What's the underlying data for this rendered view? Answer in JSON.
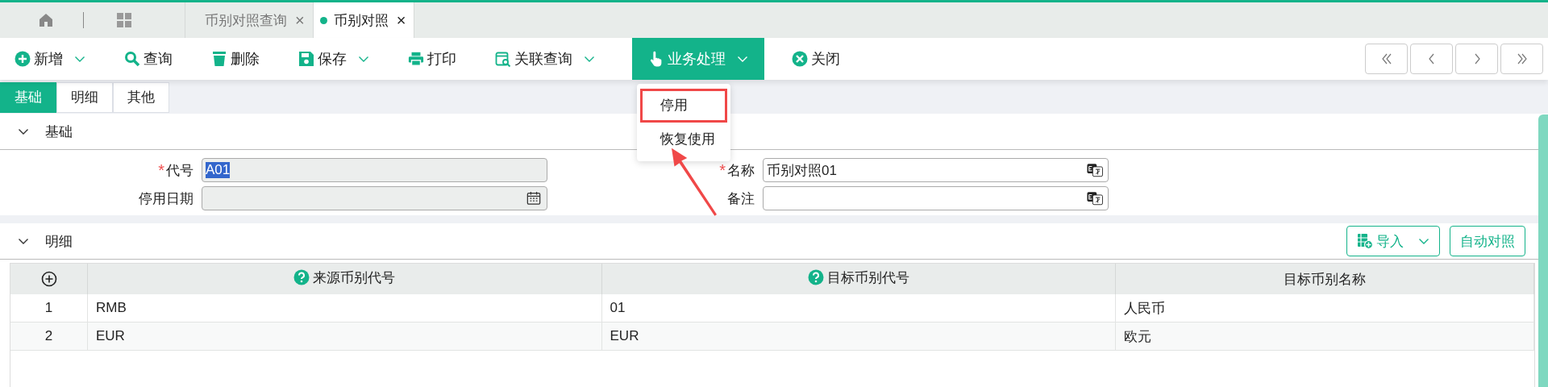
{
  "nav_tabs": [
    {
      "label": "币别对照查询",
      "selected": false,
      "close": "×"
    },
    {
      "label": "币别对照",
      "selected": true,
      "close": "×"
    }
  ],
  "toolbar": {
    "buttons": [
      {
        "label": "新增",
        "kind": "plus",
        "caret": true,
        "selected": false
      },
      {
        "label": "查询",
        "kind": "search",
        "caret": false,
        "selected": false
      },
      {
        "label": "删除",
        "kind": "trash",
        "caret": false,
        "selected": false
      },
      {
        "label": "保存",
        "kind": "save",
        "caret": true,
        "selected": false
      },
      {
        "label": "打印",
        "kind": "print",
        "caret": false,
        "selected": false
      },
      {
        "label": "关联查询",
        "kind": "docsearch",
        "caret": true,
        "selected": false
      },
      {
        "label": "业务处理",
        "kind": "hand",
        "caret": true,
        "selected": true
      },
      {
        "label": "关闭",
        "kind": "close",
        "caret": false,
        "selected": false
      }
    ],
    "pager": [
      {
        "kind": "first"
      },
      {
        "kind": "prev"
      },
      {
        "kind": "next"
      },
      {
        "kind": "last"
      }
    ]
  },
  "dropdown_menu": {
    "items": [
      {
        "label": "停用",
        "highlighted": true
      },
      {
        "label": "恢复使用",
        "highlighted": false
      }
    ]
  },
  "sub_tabs": [
    {
      "label": "基础",
      "selected": true
    },
    {
      "label": "明细",
      "selected": false
    },
    {
      "label": "其他",
      "selected": false
    }
  ],
  "basic_section": {
    "title": "基础",
    "expanded": true,
    "fields": [
      {
        "required_mark": "*",
        "label": "代号",
        "value": "A01",
        "disabled": true,
        "text_selected": true,
        "kind": "text"
      },
      {
        "required_mark": "*",
        "label": "名称",
        "value": "币别对照01",
        "disabled": false,
        "text_selected": false,
        "kind": "i18n"
      },
      {
        "label": "停用日期",
        "disabled": true,
        "kind": "date"
      },
      {
        "label": "备注",
        "disabled": false,
        "kind": "i18n"
      }
    ]
  },
  "detail_section": {
    "title": "明细",
    "expanded": true,
    "buttons": [
      {
        "label": "导入",
        "kind": "import",
        "caret": true
      },
      {
        "label": "自动对照",
        "kind": "plain",
        "caret": false
      }
    ],
    "table": {
      "columns": [
        {
          "kind": "add"
        },
        {
          "label": "来源币别代号",
          "help": true
        },
        {
          "label": "目标币别代号",
          "help": true
        },
        {
          "label": "目标币别名称",
          "help": false
        }
      ],
      "rows": [
        {
          "cells": [
            "1",
            "RMB",
            "01",
            "人民币"
          ]
        },
        {
          "cells": [
            "2",
            "EUR",
            "EUR",
            "欧元"
          ]
        }
      ]
    }
  }
}
